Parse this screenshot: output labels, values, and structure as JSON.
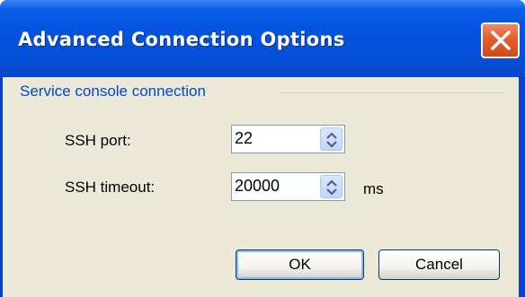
{
  "window": {
    "title": "Advanced Connection Options",
    "close_icon": "close-x-icon"
  },
  "group": {
    "label": "Service console connection"
  },
  "fields": {
    "ssh_port": {
      "label": "SSH port:",
      "value": "22"
    },
    "ssh_timeout": {
      "label": "SSH timeout:",
      "value": "20000",
      "unit": "ms"
    }
  },
  "buttons": {
    "ok": "OK",
    "cancel": "Cancel"
  },
  "colors": {
    "titlebar": "#0552df",
    "client": "#ece9d8",
    "group_label": "#0046d5",
    "close_button": "#e35d2f"
  }
}
